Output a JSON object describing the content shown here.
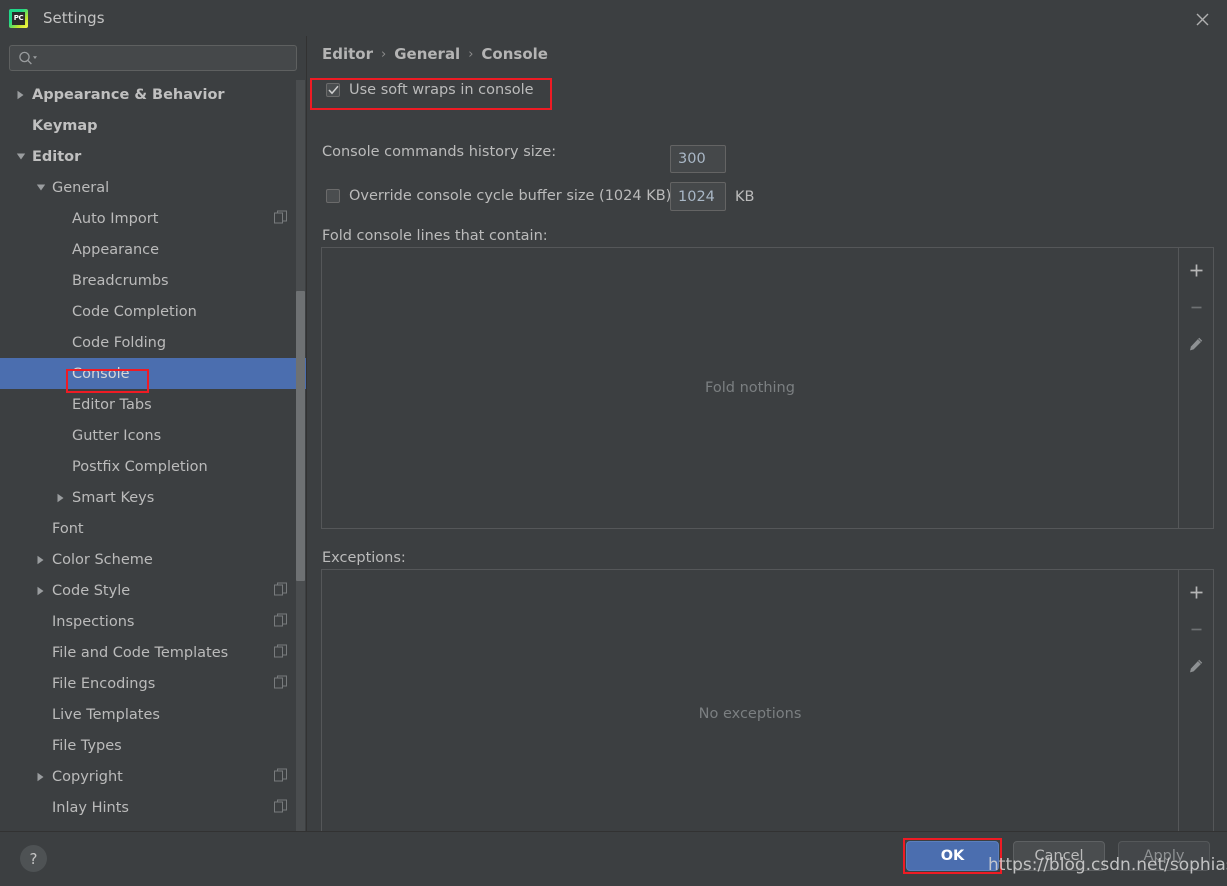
{
  "window": {
    "title": "Settings",
    "app_icon": "pycharm-logo-icon",
    "app_icon_text": "PC",
    "close_icon": "close-icon"
  },
  "search": {
    "icon": "search-icon",
    "value": "",
    "placeholder": ""
  },
  "sidebar": {
    "items": [
      {
        "label": "Appearance & Behavior",
        "indent": 0,
        "arrow": "collapsed",
        "bold": true,
        "badge": false,
        "selected": false
      },
      {
        "label": "Keymap",
        "indent": 0,
        "arrow": "none",
        "bold": true,
        "badge": false,
        "selected": false
      },
      {
        "label": "Editor",
        "indent": 0,
        "arrow": "expanded",
        "bold": true,
        "badge": false,
        "selected": false
      },
      {
        "label": "General",
        "indent": 1,
        "arrow": "expanded",
        "bold": false,
        "badge": false,
        "selected": false
      },
      {
        "label": "Auto Import",
        "indent": 2,
        "arrow": "none",
        "bold": false,
        "badge": true,
        "selected": false
      },
      {
        "label": "Appearance",
        "indent": 2,
        "arrow": "none",
        "bold": false,
        "badge": false,
        "selected": false
      },
      {
        "label": "Breadcrumbs",
        "indent": 2,
        "arrow": "none",
        "bold": false,
        "badge": false,
        "selected": false
      },
      {
        "label": "Code Completion",
        "indent": 2,
        "arrow": "none",
        "bold": false,
        "badge": false,
        "selected": false
      },
      {
        "label": "Code Folding",
        "indent": 2,
        "arrow": "none",
        "bold": false,
        "badge": false,
        "selected": false
      },
      {
        "label": "Console",
        "indent": 2,
        "arrow": "none",
        "bold": false,
        "badge": false,
        "selected": true
      },
      {
        "label": "Editor Tabs",
        "indent": 2,
        "arrow": "none",
        "bold": false,
        "badge": false,
        "selected": false
      },
      {
        "label": "Gutter Icons",
        "indent": 2,
        "arrow": "none",
        "bold": false,
        "badge": false,
        "selected": false
      },
      {
        "label": "Postfix Completion",
        "indent": 2,
        "arrow": "none",
        "bold": false,
        "badge": false,
        "selected": false
      },
      {
        "label": "Smart Keys",
        "indent": 2,
        "arrow": "collapsed",
        "bold": false,
        "badge": false,
        "selected": false
      },
      {
        "label": "Font",
        "indent": 1,
        "arrow": "none",
        "bold": false,
        "badge": false,
        "selected": false
      },
      {
        "label": "Color Scheme",
        "indent": 1,
        "arrow": "collapsed",
        "bold": false,
        "badge": false,
        "selected": false
      },
      {
        "label": "Code Style",
        "indent": 1,
        "arrow": "collapsed",
        "bold": false,
        "badge": true,
        "selected": false
      },
      {
        "label": "Inspections",
        "indent": 1,
        "arrow": "none",
        "bold": false,
        "badge": true,
        "selected": false
      },
      {
        "label": "File and Code Templates",
        "indent": 1,
        "arrow": "none",
        "bold": false,
        "badge": true,
        "selected": false
      },
      {
        "label": "File Encodings",
        "indent": 1,
        "arrow": "none",
        "bold": false,
        "badge": true,
        "selected": false
      },
      {
        "label": "Live Templates",
        "indent": 1,
        "arrow": "none",
        "bold": false,
        "badge": false,
        "selected": false
      },
      {
        "label": "File Types",
        "indent": 1,
        "arrow": "none",
        "bold": false,
        "badge": false,
        "selected": false
      },
      {
        "label": "Copyright",
        "indent": 1,
        "arrow": "collapsed",
        "bold": false,
        "badge": true,
        "selected": false
      },
      {
        "label": "Inlay Hints",
        "indent": 1,
        "arrow": "none",
        "bold": false,
        "badge": true,
        "selected": false
      }
    ]
  },
  "main": {
    "breadcrumb": {
      "root": "Editor",
      "middle": "General",
      "leaf": "Console",
      "separator": "›"
    },
    "soft_wraps": {
      "label": "Use soft wraps in console",
      "checked": true
    },
    "history": {
      "label": "Console commands history size:",
      "value": "300"
    },
    "override_buffer": {
      "label": "Override console cycle buffer size (1024 KB)",
      "checked": false,
      "value": "1024",
      "unit": "KB"
    },
    "fold_section": {
      "label": "Fold console lines that contain:",
      "empty_text": "Fold nothing",
      "toolbar": [
        {
          "name": "add-icon",
          "glyph": "+"
        },
        {
          "name": "remove-icon",
          "glyph": "−"
        },
        {
          "name": "edit-icon",
          "glyph": "✎"
        }
      ]
    },
    "exceptions_section": {
      "label": "Exceptions:",
      "empty_text": "No exceptions",
      "toolbar": [
        {
          "name": "add-icon",
          "glyph": "+"
        },
        {
          "name": "remove-icon",
          "glyph": "−"
        },
        {
          "name": "edit-icon",
          "glyph": "✎"
        }
      ]
    }
  },
  "footer": {
    "help_label": "?",
    "ok_label": "OK",
    "cancel_label": "Cancel",
    "apply_label": "Apply"
  },
  "watermark": {
    "text": "https://blog.csdn.net/sophiasofia"
  },
  "colors": {
    "background": "#3c3f41",
    "selection_blue": "#4b6eaf",
    "annotation_red": "#ee1b24",
    "field_background": "#45484a",
    "text": "#bbbbbb",
    "muted_text": "#7b7f81"
  }
}
